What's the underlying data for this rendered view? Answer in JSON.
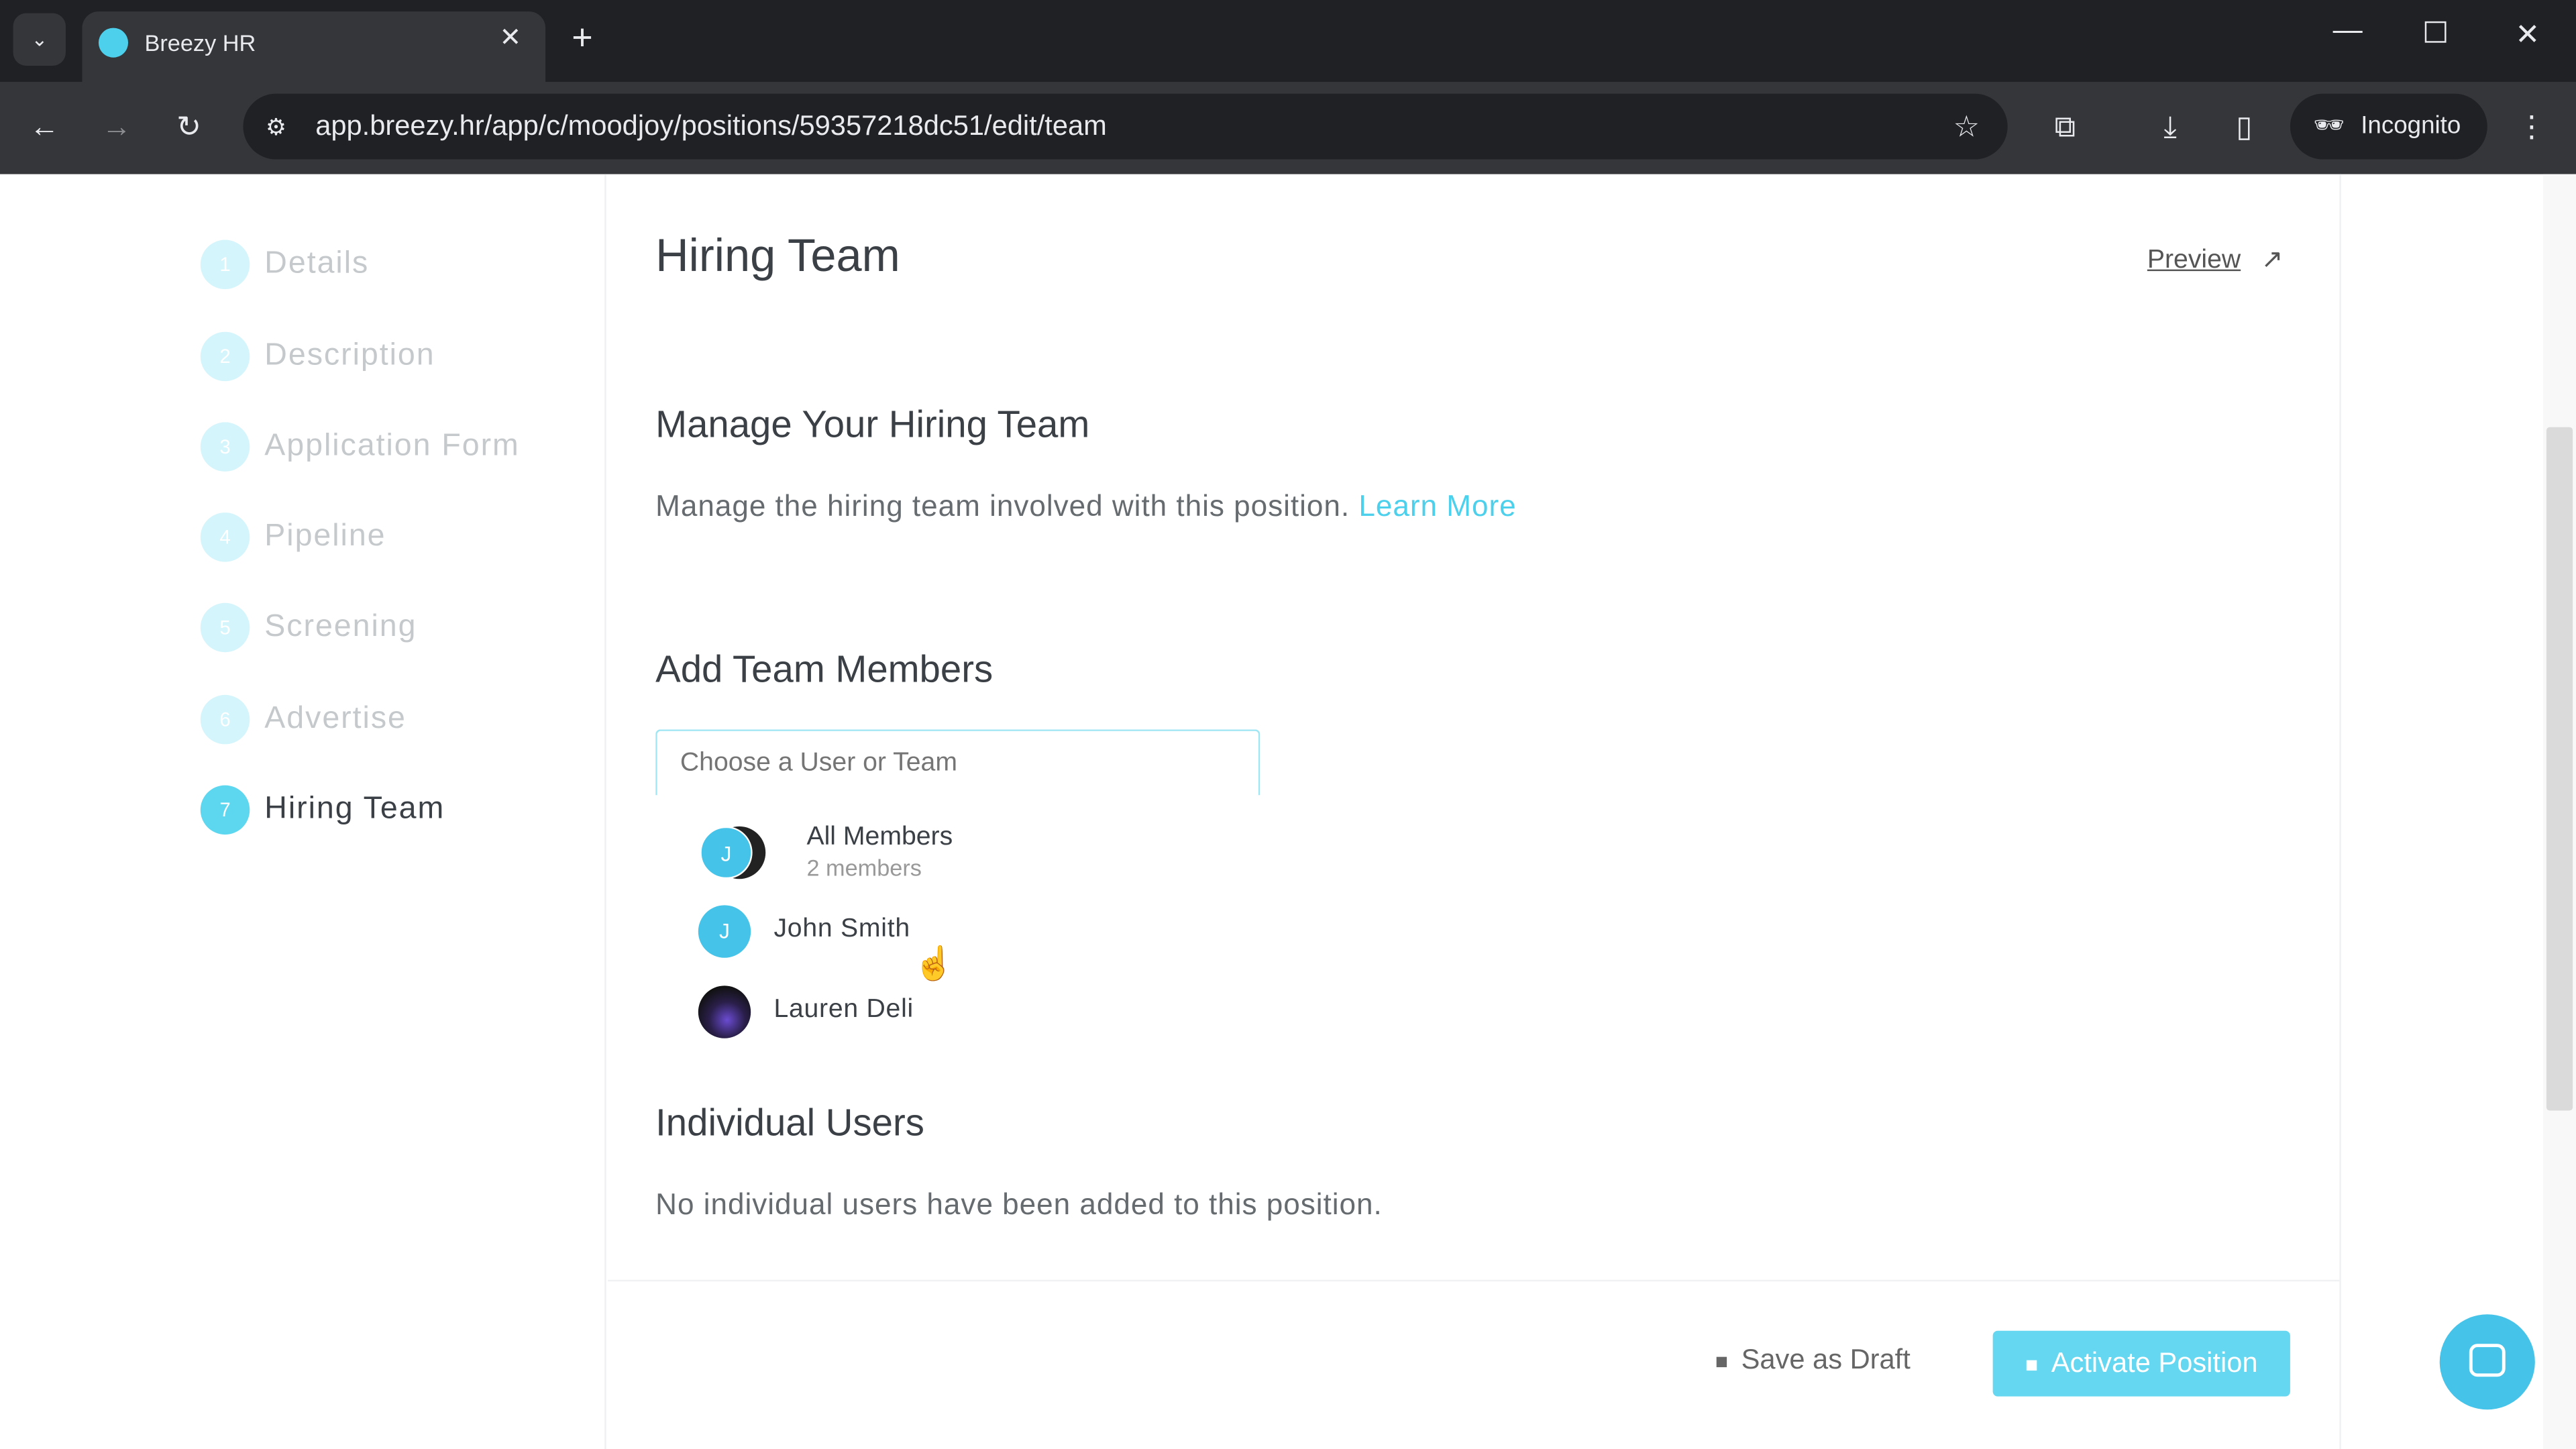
{
  "browser": {
    "tab_title": "Breezy HR",
    "url": "app.breezy.hr/app/c/moodjoy/positions/59357218dc51/edit/team",
    "incognito_label": "Incognito"
  },
  "sidebar": {
    "items": [
      {
        "num": "1",
        "label": "Details",
        "active": false
      },
      {
        "num": "2",
        "label": "Description",
        "active": false
      },
      {
        "num": "3",
        "label": "Application Form",
        "active": false
      },
      {
        "num": "4",
        "label": "Pipeline",
        "active": false
      },
      {
        "num": "5",
        "label": "Screening",
        "active": false
      },
      {
        "num": "6",
        "label": "Advertise",
        "active": false
      },
      {
        "num": "7",
        "label": "Hiring Team",
        "active": true
      }
    ]
  },
  "main": {
    "title": "Hiring Team",
    "preview_label": "Preview",
    "manage_heading": "Manage Your Hiring Team",
    "manage_text": "Manage the hiring team involved with this position.",
    "learn_more": "Learn More",
    "add_heading": "Add Team Members",
    "search_placeholder": "Choose a User or Team",
    "dropdown": {
      "team": {
        "name": "All Members",
        "count": "2 members",
        "initial": "J"
      },
      "users": [
        {
          "name": "John Smith",
          "initial": "J"
        },
        {
          "name": "Lauren Deli",
          "initial": ""
        }
      ]
    },
    "individual_heading": "Individual Users",
    "individual_empty": "No individual users have been added to this position.",
    "save_draft": "Save as Draft",
    "activate": "Activate Position"
  },
  "colors": {
    "accent": "#4dd0ec",
    "avatar": "#45c3e8"
  }
}
